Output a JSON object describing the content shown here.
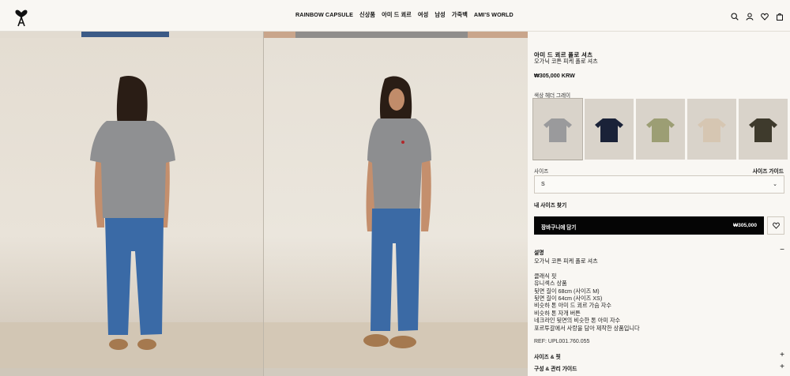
{
  "header": {
    "logo": "ami-de-coeur-logo",
    "nav": [
      "RAINBOW CAPSULE",
      "신상품",
      "아미 드 쾨르",
      "여성",
      "남성",
      "가죽백",
      "AMI'S WORLD"
    ],
    "icons": [
      "search-icon",
      "user-icon",
      "heart-icon",
      "bag-icon"
    ]
  },
  "product": {
    "name": "아미 드 쾨르 폴로 셔츠",
    "subtitle": "오가닉 코튼 피케 폴로 셔츠",
    "price": "₩305,000 KRW",
    "color_label": "색상 헤더 그레이",
    "swatches": [
      {
        "name": "heather-grey",
        "color": "#9a9a9c"
      },
      {
        "name": "navy",
        "color": "#1a2238"
      },
      {
        "name": "olive",
        "color": "#9c9e74"
      },
      {
        "name": "beige",
        "color": "#d6c6b2"
      },
      {
        "name": "dark-brown",
        "color": "#3e3a2c"
      }
    ],
    "size_label": "사이즈",
    "size_guide": "사이즈 가이드",
    "size_value": "S",
    "find_size": "내 사이즈 찾기",
    "add_to_cart": "장바구니에 담기",
    "add_price": "₩305,000",
    "description_title": "설명",
    "description_lines": [
      "오가닉 코튼 피케 폴로 셔츠",
      "",
      "클래식 핏",
      "유니섹스 상품",
      "뒷면 길이 68cm (사이즈 M)",
      "뒷면 길이 64cm (사이즈 XS)",
      "비슷하 톤 아미 드 쾨르 가슴 자수",
      "비슷하 톤 자개 버튼",
      "네크라인 뒷면의 비슷한 톤 아미 자수",
      "포르투갈에서 사랑을 담아 제작한 상품입니다"
    ],
    "ref": "REF: UPL001.760.055",
    "accordions": [
      "사이즈 & 핏",
      "구성 & 관리 가이드"
    ]
  }
}
